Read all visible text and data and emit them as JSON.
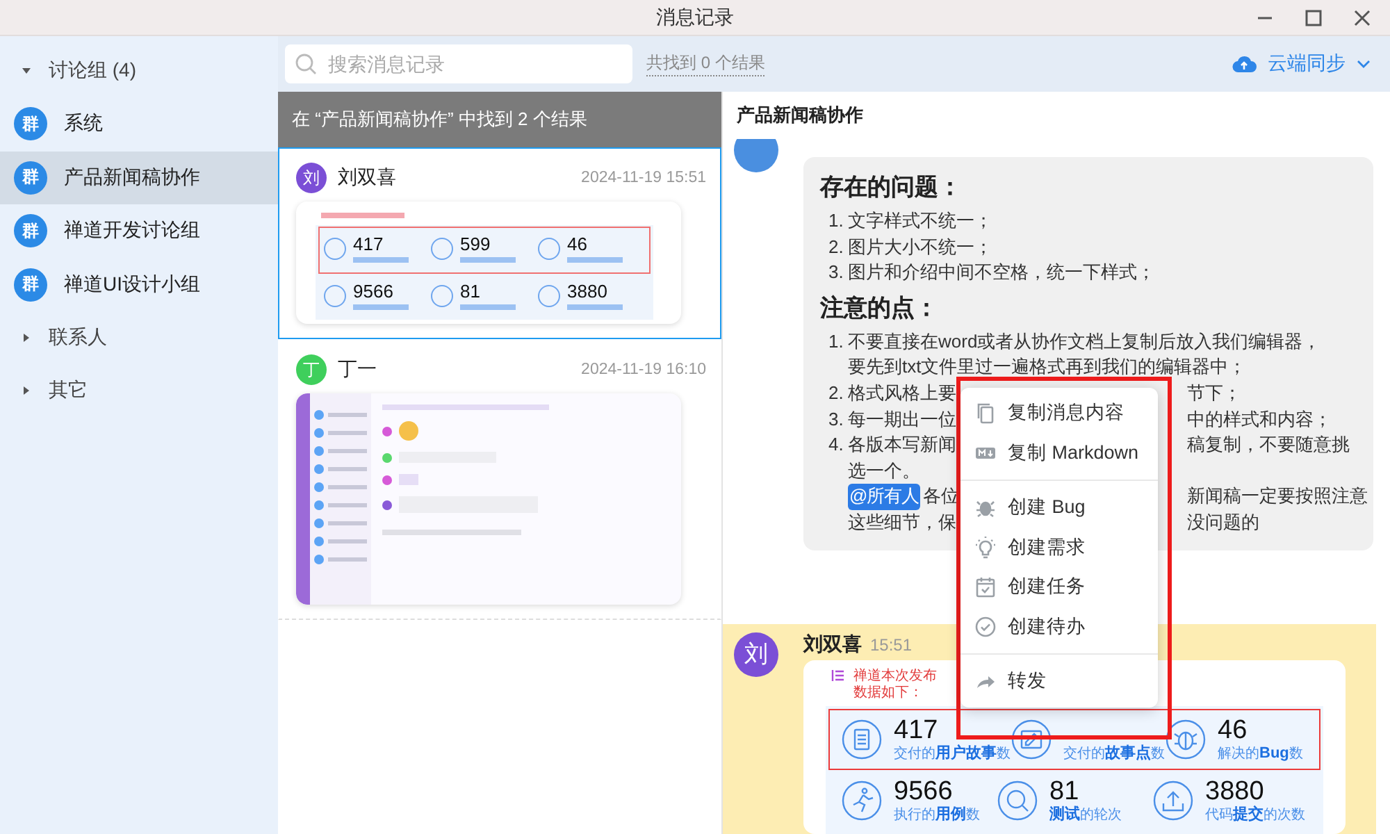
{
  "window": {
    "title": "消息记录"
  },
  "sidebar": {
    "groups": [
      {
        "label": "讨论组 (4)",
        "expanded": true,
        "items": [
          {
            "avatar": "群",
            "name": "系统",
            "selected": false
          },
          {
            "avatar": "群",
            "name": "产品新闻稿协作",
            "selected": true
          },
          {
            "avatar": "群",
            "name": "禅道开发讨论组",
            "selected": false
          },
          {
            "avatar": "群",
            "name": "禅道UI设计小组",
            "selected": false
          }
        ]
      },
      {
        "label": "联系人",
        "expanded": false
      },
      {
        "label": "其它",
        "expanded": false
      }
    ]
  },
  "search": {
    "placeholder": "搜索消息记录",
    "result_count": "共找到 0 个结果"
  },
  "sync_button": {
    "label": "云端同步"
  },
  "results": {
    "header": "在 “产品新闻稿协作” 中找到 2 个结果",
    "items": [
      {
        "kind": "stats",
        "avatar": "刘",
        "color": "#7b4fd6",
        "name": "刘双喜",
        "time": "2024-11-19 15:51",
        "selected": true,
        "numbers": [
          "417",
          "599",
          "46",
          "9566",
          "81",
          "3880"
        ]
      },
      {
        "kind": "screenshot",
        "avatar": "丁",
        "color": "#3fcf5c",
        "name": "丁一",
        "time": "2024-11-19 16:10",
        "selected": false
      }
    ]
  },
  "chat": {
    "title": "产品新闻稿协作",
    "messages": [
      {
        "kind": "notes",
        "color": "#4a8fe0",
        "sections": [
          {
            "heading": "存在的问题：",
            "items": [
              {
                "number": "1.",
                "lines": [
                  {
                    "text": "文字样式不统一；"
                  }
                ]
              },
              {
                "number": "2.",
                "lines": [
                  {
                    "text": "图片大小不统一；"
                  }
                ]
              },
              {
                "number": "3.",
                "lines": [
                  {
                    "text": "图片和介绍中间不空格，统一下样式；"
                  }
                ]
              }
            ]
          },
          {
            "heading": "注意的点：",
            "items": [
              {
                "number": "1.",
                "lines": [
                  {
                    "text": "不要直接在word或者从协作文档上复制后放入我们编辑器，"
                  },
                  {
                    "text": "要先到txt文件里过一遍格式再到我们的编辑器中；"
                  }
                ]
              },
              {
                "number": "2.",
                "lines": [
                  {
                    "text": "格式风格上要",
                    "after_gap": "节下；"
                  }
                ]
              },
              {
                "number": "3.",
                "lines": [
                  {
                    "text": "每一期出一位",
                    "after_gap": "中的样式和内容；"
                  }
                ]
              },
              {
                "number": "4.",
                "lines": [
                  {
                    "text": "各版本写新闻",
                    "after_gap": "稿复制，不要随意挑"
                  },
                  {
                    "text": "选一个。"
                  },
                  {
                    "mention": "@所有人",
                    "text": "各位",
                    "after_gap": "新闻稿一定要按照注意"
                  },
                  {
                    "text": "这些细节，保",
                    "after_gap": "没问题的"
                  }
                ]
              }
            ]
          }
        ]
      },
      {
        "kind": "stats",
        "avatar": "刘",
        "color": "#7b4fd6",
        "name": "刘双喜",
        "time": "15:51",
        "highlighted": true,
        "caption": "禅道本次发布数据如下：",
        "rows": [
          {
            "highlighted": true,
            "stats": [
              {
                "kind": "document",
                "value": "417",
                "label": "交付的**用户故事**数"
              },
              {
                "kind": "edit",
                "label": "交付的**故事点**数"
              },
              {
                "kind": "bug",
                "value": "46",
                "label": "解决的**Bug**数"
              }
            ]
          },
          {
            "highlighted": false,
            "stats": [
              {
                "kind": "run",
                "value": "9566",
                "label": "执行的**用例**数"
              },
              {
                "kind": "search",
                "value": "81",
                "label": "**测试**的轮次"
              },
              {
                "kind": "upload",
                "value": "3880",
                "label": "代码**提交**的次数"
              }
            ]
          }
        ]
      }
    ]
  },
  "context_menu": {
    "groups": [
      {
        "items": [
          {
            "kind": "copy",
            "label": "复制消息内容"
          },
          {
            "kind": "markdown",
            "label": "复制 Markdown"
          }
        ]
      },
      {
        "items": [
          {
            "kind": "bug",
            "label": "创建 Bug"
          },
          {
            "kind": "bulb",
            "label": "创建需求"
          },
          {
            "kind": "calendar",
            "label": "创建任务"
          },
          {
            "kind": "check",
            "label": "创建待办"
          }
        ]
      },
      {
        "items": [
          {
            "kind": "forward",
            "label": "转发"
          }
        ]
      }
    ]
  }
}
